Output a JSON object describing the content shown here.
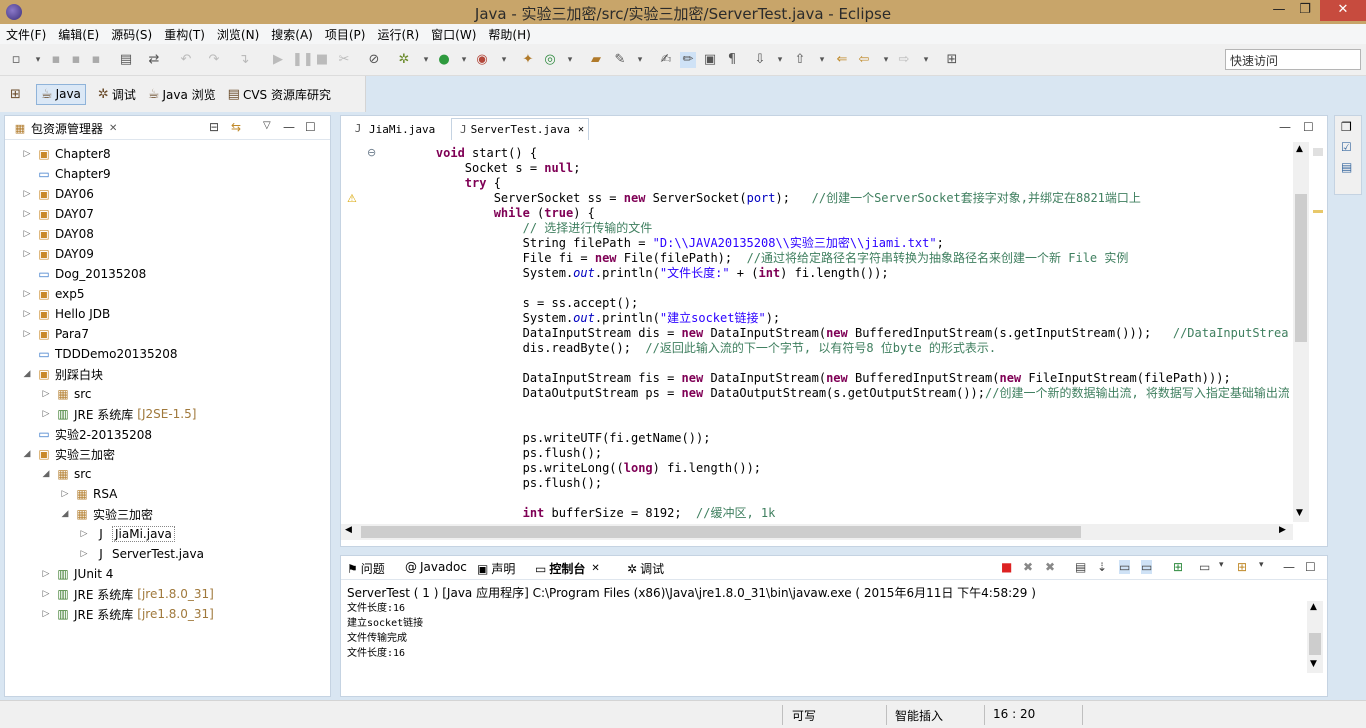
{
  "window": {
    "title": "Java  -  实验三加密/src/实验三加密/ServerTest.java  -  Eclipse",
    "min": "—",
    "max": "❐",
    "close": "✕"
  },
  "menu": [
    "文件(F)",
    "编辑(E)",
    "源码(S)",
    "重构(T)",
    "浏览(N)",
    "搜索(A)",
    "项目(P)",
    "运行(R)",
    "窗口(W)",
    "帮助(H)"
  ],
  "quick_access": {
    "placeholder": "快速访问"
  },
  "perspectives": [
    {
      "label": "Java",
      "icon": "java-perspective-icon",
      "glyph": "☕",
      "active": true
    },
    {
      "label": "调试",
      "icon": "debug-icon",
      "glyph": "✲"
    },
    {
      "label": "Java 浏览",
      "icon": "java-browse-icon",
      "glyph": "☕"
    },
    {
      "label": "CVS 资源库研究",
      "icon": "cvs-icon",
      "glyph": "▤"
    }
  ],
  "package_explorer": {
    "title": "包资源管理器",
    "items": [
      {
        "label": "Chapter8",
        "level": 0,
        "icon": "project-icon",
        "twist": "▷"
      },
      {
        "label": "Chapter9",
        "level": 0,
        "icon": "folder-icon",
        "twist": ""
      },
      {
        "label": "DAY06",
        "level": 0,
        "icon": "project-icon",
        "twist": "▷"
      },
      {
        "label": "DAY07",
        "level": 0,
        "icon": "project-icon",
        "twist": "▷"
      },
      {
        "label": "DAY08",
        "level": 0,
        "icon": "project-icon",
        "twist": "▷"
      },
      {
        "label": "DAY09",
        "level": 0,
        "icon": "project-icon",
        "twist": "▷"
      },
      {
        "label": "Dog_20135208",
        "level": 0,
        "icon": "folder-icon",
        "twist": ""
      },
      {
        "label": "exp5",
        "level": 0,
        "icon": "project-icon",
        "twist": "▷"
      },
      {
        "label": "Hello JDB",
        "level": 0,
        "icon": "project-icon",
        "twist": "▷"
      },
      {
        "label": "Para7",
        "level": 0,
        "icon": "project-icon",
        "twist": "▷"
      },
      {
        "label": "TDDDemo20135208",
        "level": 0,
        "icon": "folder-icon",
        "twist": ""
      },
      {
        "label": "别踩白块",
        "level": 0,
        "icon": "project-icon",
        "twist": "◢"
      },
      {
        "label": "src",
        "level": 1,
        "icon": "source-folder-icon",
        "twist": "▷"
      },
      {
        "label": "JRE 系统库",
        "suffix": "[J2SE-1.5]",
        "level": 1,
        "icon": "library-icon",
        "twist": "▷"
      },
      {
        "label": "实验2-20135208",
        "level": 0,
        "icon": "folder-icon",
        "twist": ""
      },
      {
        "label": "实验三加密",
        "level": 0,
        "icon": "project-icon",
        "twist": "◢"
      },
      {
        "label": "src",
        "level": 1,
        "icon": "source-folder-icon",
        "twist": "◢"
      },
      {
        "label": "RSA",
        "level": 2,
        "icon": "package-icon",
        "twist": "▷"
      },
      {
        "label": "实验三加密",
        "level": 2,
        "icon": "package-icon",
        "twist": "◢"
      },
      {
        "label": "JiaMi.java",
        "level": 3,
        "icon": "java-file-icon",
        "twist": "▷",
        "selected": true
      },
      {
        "label": "ServerTest.java",
        "level": 3,
        "icon": "java-file-icon",
        "twist": "▷"
      },
      {
        "label": "JUnit 4",
        "level": 1,
        "icon": "library-icon",
        "twist": "▷"
      },
      {
        "label": "JRE 系统库",
        "suffix": "[jre1.8.0_31]",
        "level": 1,
        "icon": "library-icon",
        "twist": "▷"
      },
      {
        "label": "JRE 系统库",
        "suffix": "[jre1.8.0_31]",
        "level": 1,
        "icon": "library-icon",
        "twist": "▷"
      }
    ]
  },
  "editor": {
    "tabs": [
      {
        "label": "JiaMi.java",
        "active": false
      },
      {
        "label": "ServerTest.java",
        "active": true
      }
    ],
    "lines": [
      "    void start() {",
      "        Socket s = null;",
      "        try {",
      "            ServerSocket ss = new ServerSocket(port);   //创建一个ServerSocket套接字对象,并绑定在8821端口上",
      "            while (true) {",
      "                // 选择进行传输的文件",
      "                String filePath = \"D:\\\\JAVA20135208\\\\实验三加密\\\\jiami.txt\";",
      "                File fi = new File(filePath);  //通过将给定路径名字符串转换为抽象路径名来创建一个新 File 实例",
      "                System.out.println(\"文件长度:\" + (int) fi.length());",
      "",
      "                s = ss.accept();",
      "                System.out.println(\"建立socket链接\");",
      "                DataInputStream dis = new DataInputStream(new BufferedInputStream(s.getInputStream()));   //DataInputStream:使用指定的",
      "                dis.readByte();  //返回此输入流的下一个字节, 以有符号8 位byte 的形式表示.",
      "",
      "                DataInputStream fis = new DataInputStream(new BufferedInputStream(new FileInputStream(filePath)));",
      "                DataOutputStream ps = new DataOutputStream(s.getOutputStream());//创建一个新的数据输出流, 将数据写入指定基础输出流",
      "",
      "",
      "                ps.writeUTF(fi.getName());",
      "                ps.flush();",
      "                ps.writeLong((long) fi.length());",
      "                ps.flush();",
      "",
      "                int bufferSize = 8192;  //缓冲区, 1k"
    ]
  },
  "console": {
    "tabs": [
      {
        "label": "问题",
        "icon": "problems-icon",
        "glyph": "⚑"
      },
      {
        "label": "Javadoc",
        "icon": "javadoc-icon",
        "glyph": "@"
      },
      {
        "label": "声明",
        "icon": "declaration-icon",
        "glyph": "▣"
      },
      {
        "label": "控制台",
        "icon": "console-icon",
        "glyph": "▭",
        "active": true
      },
      {
        "label": "调试",
        "icon": "debug-icon",
        "glyph": "✲"
      }
    ],
    "header": "ServerTest ( 1 )  [Java 应用程序] C:\\Program Files (x86)\\Java\\jre1.8.0_31\\bin\\javaw.exe ( 2015年6月11日 下午4:58:29 )",
    "lines": [
      "文件长度:16",
      "建立socket链接",
      "文件传输完成",
      "文件长度:16"
    ]
  },
  "status": {
    "writable": "可写",
    "insert_mode": "智能插入",
    "position": "16 : 20"
  },
  "colors": {
    "titlebar": "#c8a56a",
    "keyword": "#7f0055",
    "comment": "#3f7f5f",
    "string": "#2a00ff"
  }
}
